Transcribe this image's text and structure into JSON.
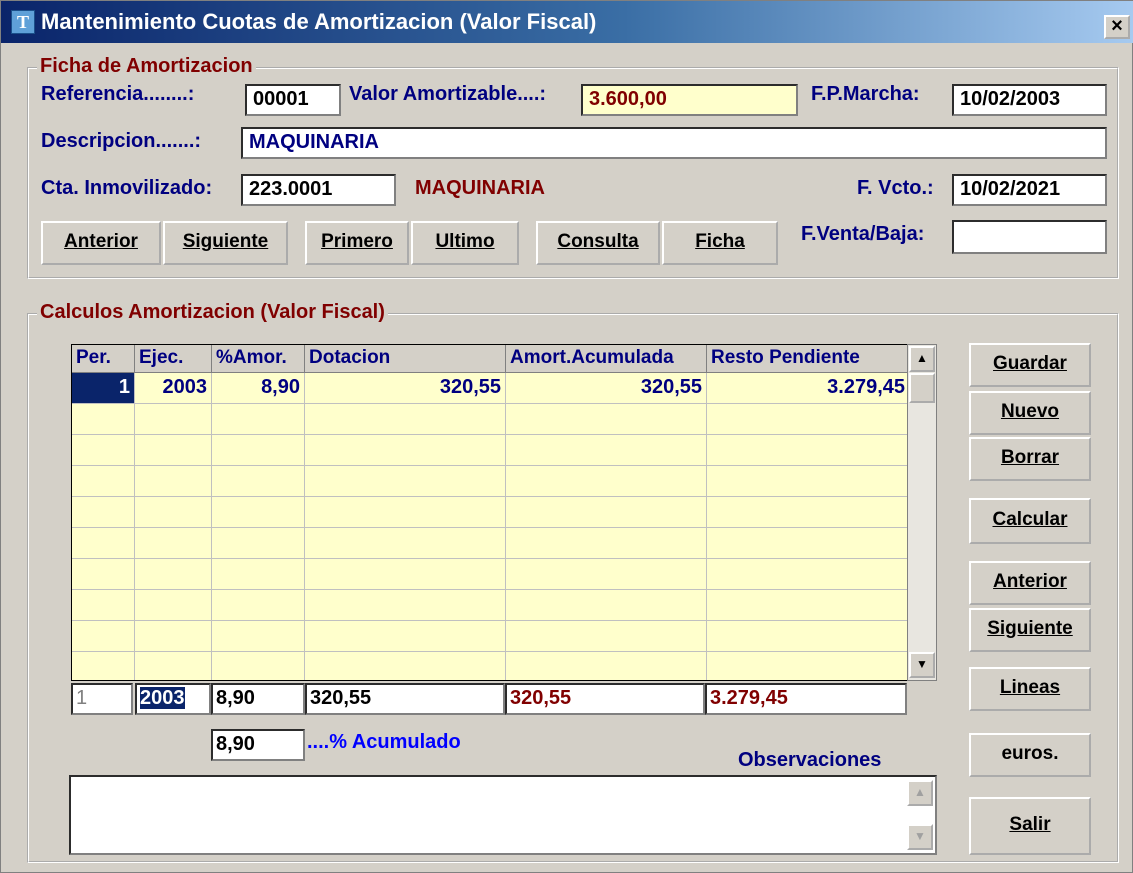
{
  "window": {
    "title": "Mantenimiento Cuotas de Amortizacion (Valor Fiscal)",
    "close_glyph": "×",
    "icon": "app-icon"
  },
  "ficha": {
    "legend": "Ficha de Amortizacion",
    "referencia_label": "Referencia........:",
    "referencia_value": "00001",
    "valor_label": "Valor Amortizable....:",
    "valor_value": "3.600,00",
    "fpmarcha_label": "F.P.Marcha:",
    "fpmarcha_value": "10/02/2003",
    "descripcion_label": "Descripcion.......:",
    "descripcion_value": "MAQUINARIA",
    "cta_label": "Cta. Inmovilizado:",
    "cta_value": "223.0001",
    "cta_desc": "MAQUINARIA",
    "fvcto_label": "F. Vcto.:",
    "fvcto_value": "10/02/2021",
    "fventa_label": "F.Venta/Baja:",
    "fventa_value": "",
    "buttons": {
      "anterior": "Anterior",
      "siguiente": "Siguiente",
      "primero": "Primero",
      "ultimo": "Ultimo",
      "consulta": "Consulta",
      "ficha": "Ficha"
    }
  },
  "calculos": {
    "legend": "Calculos Amortizacion (Valor Fiscal)",
    "columns": [
      "Per.",
      "Ejec.",
      "%Amor.",
      "Dotacion",
      "Amort.Acumulada",
      "Resto Pendiente"
    ],
    "rows": [
      [
        "1",
        "2003",
        "8,90",
        "320,55",
        "320,55",
        "3.279,45"
      ]
    ],
    "edit_row": {
      "per": "1",
      "ejec": "2003",
      "amor": "8,90",
      "dotacion": "320,55",
      "acumulada": "320,55",
      "resto": "3.279,45"
    },
    "acumulado_value": "8,90",
    "acumulado_label": "....% Acumulado",
    "observaciones_label": "Observaciones",
    "observaciones_value": ""
  },
  "side_buttons": {
    "guardar": "Guardar",
    "nuevo": "Nuevo",
    "borrar": "Borrar",
    "calcular": "Calcular",
    "anterior": "Anterior",
    "siguiente": "Siguiente",
    "lineas": "Lineas",
    "euros": "euros.",
    "salir": "Salir"
  },
  "colors": {
    "window_bg": "#d4d0c8",
    "grid_bg": "#ffffcc",
    "legend": "#800000",
    "label": "#000080",
    "selected": "#0a246a"
  }
}
